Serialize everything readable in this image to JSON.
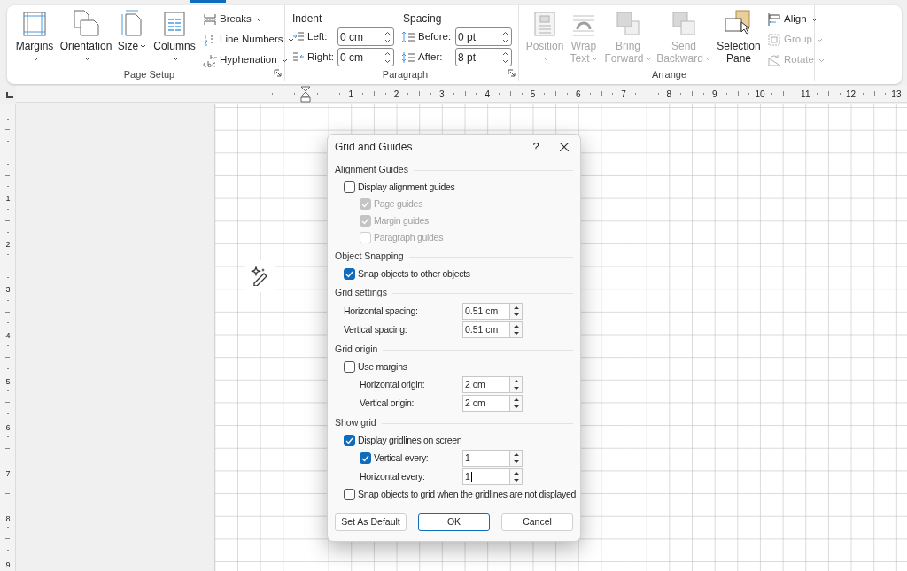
{
  "ribbon": {
    "groups": [
      {
        "kind": "page_setup",
        "label": "Page Setup",
        "launcher": true,
        "large_buttons": [
          {
            "label": "Margins",
            "dropdown": true,
            "disabled": false
          },
          {
            "label": "Orientation",
            "dropdown": true,
            "disabled": false
          },
          {
            "label": "Size",
            "dropdown": true,
            "disabled": false
          },
          {
            "label": "Columns",
            "dropdown": true,
            "disabled": false
          }
        ],
        "small_buttons": [
          {
            "label": "Breaks",
            "disabled": false
          },
          {
            "label": "Line Numbers",
            "disabled": false
          },
          {
            "label": "Hyphenation",
            "disabled": false
          }
        ]
      },
      {
        "kind": "paragraph",
        "label": "Paragraph",
        "launcher": true,
        "indent_label": "Indent",
        "spacing_label": "Spacing",
        "fields": [
          {
            "label": "Left:",
            "value": "0 cm"
          },
          {
            "label": "Right:",
            "value": "0 cm"
          },
          {
            "label": "Before:",
            "value": "0 pt"
          },
          {
            "label": "After:",
            "value": "8 pt"
          }
        ]
      },
      {
        "kind": "arrange",
        "label": "Arrange",
        "launcher": false,
        "large_buttons": [
          {
            "label": "Position",
            "dropdown": true,
            "disabled": true
          },
          {
            "label": "Wrap Text",
            "dropdown": true,
            "disabled": true
          },
          {
            "label": "Bring Forward",
            "dropdown": true,
            "disabled": true
          },
          {
            "label": "Send Backward",
            "dropdown": true,
            "disabled": true
          },
          {
            "label": "Selection Pane",
            "dropdown": false,
            "disabled": false
          }
        ],
        "small_buttons": [
          {
            "label": "Align",
            "disabled": false
          },
          {
            "label": "Group",
            "disabled": true
          },
          {
            "label": "Rotate",
            "disabled": true
          }
        ]
      }
    ]
  },
  "horizontal_ruler": {
    "labels": [
      "1",
      "2",
      "3",
      "4",
      "5",
      "6",
      "7",
      "8",
      "9",
      "10",
      "11",
      "12",
      "13"
    ]
  },
  "vertical_ruler": {
    "labels": [
      "1",
      "2",
      "3",
      "4",
      "5",
      "6",
      "7",
      "8",
      "9"
    ]
  },
  "dialog": {
    "title": "Grid and Guides",
    "help": "?",
    "sections": [
      {
        "heading": "Alignment Guides",
        "items": [
          {
            "kind": "checkbox",
            "label": "Display alignment guides",
            "checked": false,
            "disabled": false,
            "children": [
              {
                "kind": "checkbox",
                "label": "Page guides",
                "checked": true,
                "disabled": true
              },
              {
                "kind": "checkbox",
                "label": "Margin guides",
                "checked": true,
                "disabled": true
              },
              {
                "kind": "checkbox",
                "label": "Paragraph guides",
                "checked": false,
                "disabled": true
              }
            ]
          }
        ]
      },
      {
        "heading": "Object Snapping",
        "items": [
          {
            "kind": "checkbox",
            "label": "Snap objects to other objects",
            "checked": true,
            "disabled": false
          }
        ]
      },
      {
        "heading": "Grid settings",
        "items": [
          {
            "kind": "spin",
            "label": "Horizontal spacing:",
            "value": "0.51 cm"
          },
          {
            "kind": "spin",
            "label": "Vertical spacing:",
            "value": "0.51 cm"
          }
        ]
      },
      {
        "heading": "Grid origin",
        "items": [
          {
            "kind": "checkbox",
            "label": "Use margins",
            "checked": false,
            "disabled": false,
            "children": [
              {
                "kind": "spin",
                "label": "Horizontal origin:",
                "value": "2 cm"
              },
              {
                "kind": "spin",
                "label": "Vertical origin:",
                "value": "2 cm"
              }
            ]
          }
        ]
      },
      {
        "heading": "Show grid",
        "items": [
          {
            "kind": "checkbox",
            "label": "Display gridlines on screen",
            "checked": true,
            "disabled": false,
            "children": [
              {
                "kind": "checkbox_spin",
                "label": "Vertical every:",
                "checked": true,
                "disabled": false,
                "value": "1"
              },
              {
                "kind": "spin",
                "label": "Horizontal every:",
                "value": "1",
                "focused": true
              }
            ]
          },
          {
            "kind": "checkbox",
            "label": "Snap objects to grid when the gridlines are not displayed",
            "checked": false,
            "disabled": false
          }
        ]
      }
    ],
    "buttons": [
      {
        "label": "Set As Default",
        "default": false
      },
      {
        "label": "OK",
        "default": true
      },
      {
        "label": "Cancel",
        "default": false
      }
    ]
  }
}
